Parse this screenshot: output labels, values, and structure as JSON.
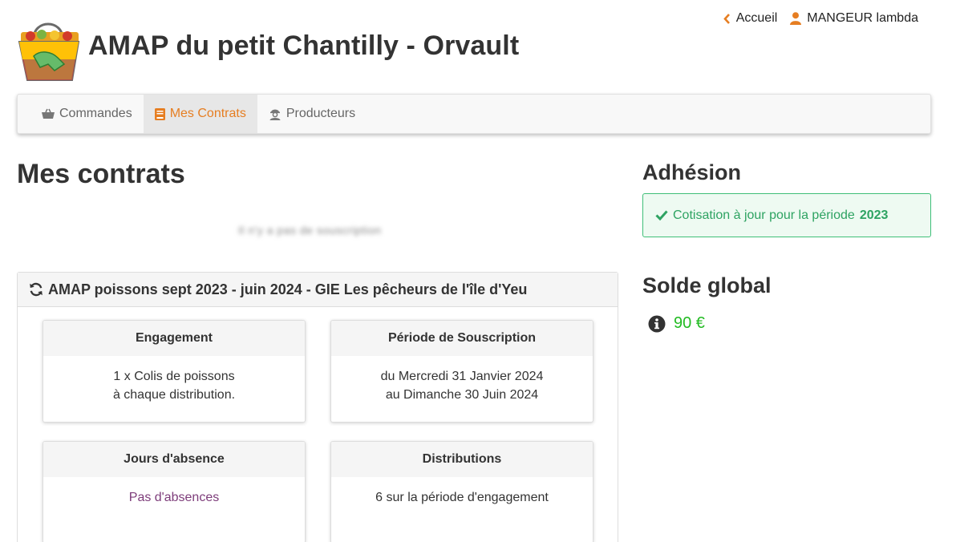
{
  "header": {
    "site_title": "AMAP du petit Chantilly - Orvault",
    "accueil_label": "Accueil",
    "user_label": "MANGEUR lambda"
  },
  "nav": {
    "items": [
      {
        "label": "Commandes",
        "icon": "basket-icon",
        "active": false
      },
      {
        "label": "Mes Contrats",
        "icon": "book-icon",
        "active": true
      },
      {
        "label": "Producteurs",
        "icon": "producer-icon",
        "active": false
      }
    ]
  },
  "main": {
    "page_title": "Mes contrats",
    "blurred_text": "Il n'y a pas de souscription",
    "contract": {
      "title": "AMAP poissons sept 2023 - juin 2024 - GIE Les pêcheurs de l'île d'Yeu",
      "engagement": {
        "title": "Engagement",
        "line1": "1 x Colis de poissons",
        "line2": "à chaque distribution."
      },
      "periode": {
        "title": "Période de Souscription",
        "line1": "du Mercredi 31 Janvier 2024",
        "line2": "au Dimanche 30 Juin 2024"
      },
      "absences": {
        "title": "Jours d'absence",
        "value": "Pas d'absences"
      },
      "distributions": {
        "title": "Distributions",
        "value": "6 sur la période d'engagement"
      }
    }
  },
  "sidebar": {
    "adhesion_title": "Adhésion",
    "cotisation_text": "Cotisation à jour pour la période",
    "cotisation_year": "2023",
    "solde_title": "Solde global",
    "solde_value": "90 €"
  },
  "colors": {
    "accent": "#e67e22",
    "success": "#2ea362",
    "solde": "#22bb22"
  }
}
